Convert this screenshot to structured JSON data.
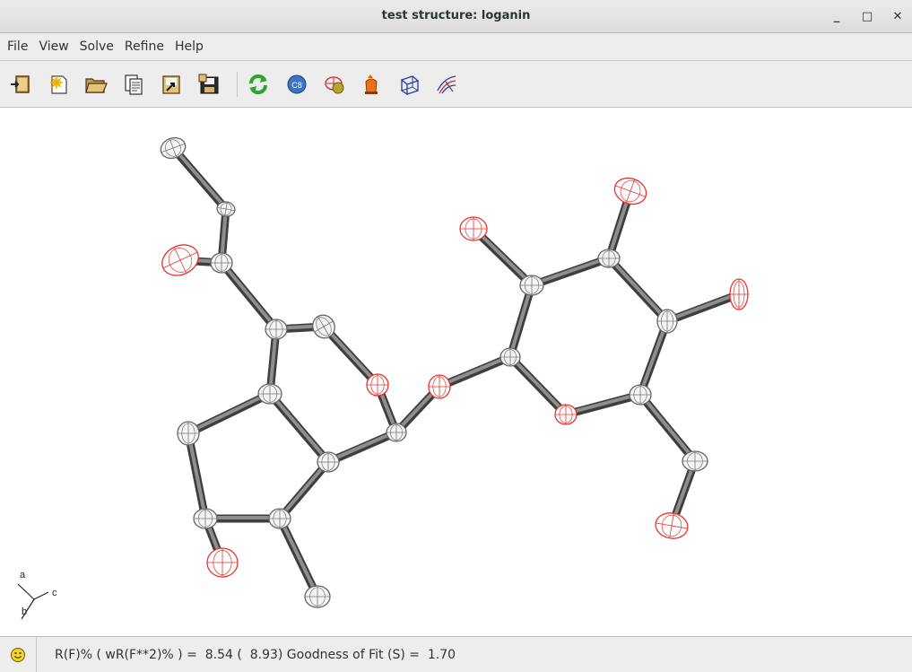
{
  "window": {
    "title": "test structure: loganin",
    "minimize_glyph": "_",
    "maximize_glyph": "□",
    "close_glyph": "✕"
  },
  "menu": [
    "File",
    "View",
    "Solve",
    "Refine",
    "Help"
  ],
  "toolbar": {
    "icons": [
      "import-icon",
      "new-icon",
      "open-folder-icon",
      "report-icon",
      "export-icon",
      "save-icon",
      "refresh-icon",
      "c8-icon",
      "atom-icon",
      "lamp-icon",
      "cell-box-icon",
      "projection-icon"
    ],
    "c8_label": "C8"
  },
  "axes": {
    "a": "a",
    "b": "b",
    "c": "c"
  },
  "status": {
    "text": "R(F)% ( wR(F**2)% ) =  8.54 (  8.93) Goodness of Fit (S) =  1.70",
    "icon": "smiley-icon"
  },
  "colors": {
    "carbon": "#ffffff",
    "oxygen": "#e8332c",
    "bond": "#666666",
    "toolbar_bg": "#ededed"
  }
}
